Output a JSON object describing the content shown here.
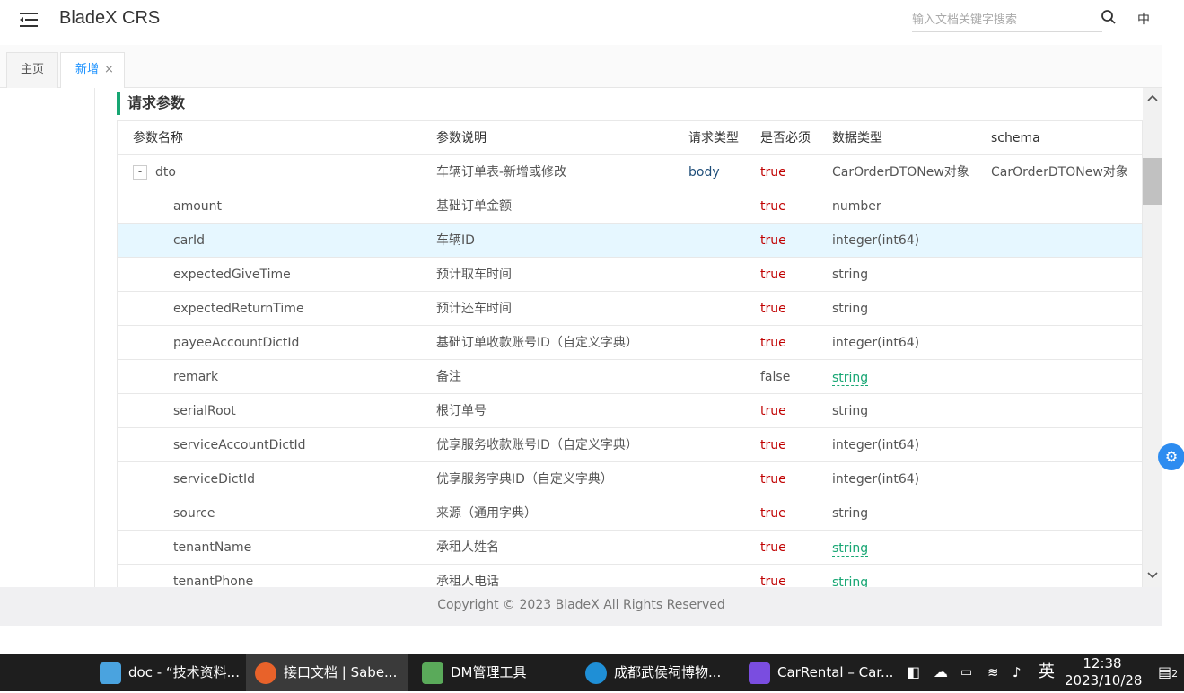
{
  "header": {
    "app_title": "BladeX CRS",
    "search_placeholder": "输入文档关键字搜索",
    "lang": "中"
  },
  "tabs": [
    {
      "label": "主页",
      "active": false
    },
    {
      "label": "新增",
      "active": true,
      "close": "×"
    }
  ],
  "section": {
    "title": "请求参数"
  },
  "table": {
    "headers": {
      "name": "参数名称",
      "desc": "参数说明",
      "in": "请求类型",
      "required": "是否必须",
      "type": "数据类型",
      "schema": "schema"
    },
    "parent": {
      "expand": "-",
      "name": "dto",
      "desc": "车辆订单表-新增或修改",
      "in": "body",
      "required": "true",
      "type": "CarOrderDTONew对象",
      "schema": "CarOrderDTONew对象"
    },
    "rows": [
      {
        "name": "amount",
        "desc": "基础订单金额",
        "required": "true",
        "type": "number"
      },
      {
        "name": "carId",
        "desc": "车辆ID",
        "required": "true",
        "type": "integer(int64)"
      },
      {
        "name": "expectedGiveTime",
        "desc": "预计取车时间",
        "required": "true",
        "type": "string"
      },
      {
        "name": "expectedReturnTime",
        "desc": "预计还车时间",
        "required": "true",
        "type": "string"
      },
      {
        "name": "payeeAccountDictId",
        "desc": "基础订单收款账号ID（自定义字典）",
        "required": "true",
        "type": "integer(int64)"
      },
      {
        "name": "remark",
        "desc": "备注",
        "required": "false",
        "type": "string"
      },
      {
        "name": "serialRoot",
        "desc": "根订单号",
        "required": "true",
        "type": "string"
      },
      {
        "name": "serviceAccountDictId",
        "desc": "优享服务收款账号ID（自定义字典）",
        "required": "true",
        "type": "integer(int64)"
      },
      {
        "name": "serviceDictId",
        "desc": "优享服务字典ID（自定义字典）",
        "required": "true",
        "type": "integer(int64)"
      },
      {
        "name": "source",
        "desc": "来源（通用字典）",
        "required": "true",
        "type": "string"
      },
      {
        "name": "tenantName",
        "desc": "承租人姓名",
        "required": "true",
        "type": "string"
      },
      {
        "name": "tenantPhone",
        "desc": "承租人电话",
        "required": "true",
        "type": "string"
      }
    ]
  },
  "footer": {
    "copyright": "Copyright © 2023 BladeX All Rights Reserved"
  },
  "taskbar": {
    "tasks": [
      {
        "label": "doc - “技术资料...",
        "icon_color": "#4aa3df"
      },
      {
        "label": "接口文档 | Sabe...",
        "icon_color": "#e8622a"
      },
      {
        "label": "DM管理工具",
        "icon_color": "#5aaa5a"
      },
      {
        "label": "成都武侯祠博物...",
        "icon_color": "#1f8fd6"
      },
      {
        "label": "CarRental – Car...",
        "icon_color": "#7a4de0"
      }
    ],
    "ime": "英",
    "time": "12:38",
    "date": "2023/10/28",
    "notifications": "2"
  },
  "colors": {
    "accent": "#1890ff",
    "green": "#17a673",
    "required": "#c00000",
    "highlight": "#e6f7ff"
  }
}
